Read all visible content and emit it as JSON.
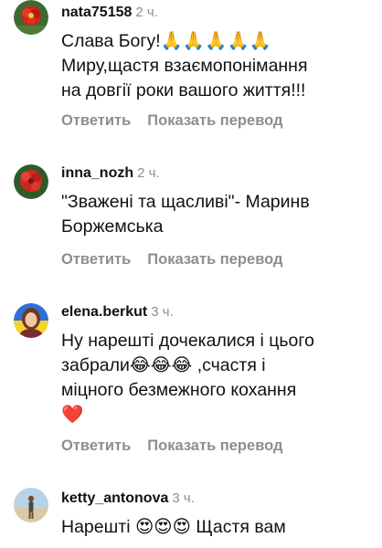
{
  "comments": [
    {
      "username": "nata75158",
      "time": "2 ч.",
      "text": "Слава Богу!🙏🙏🙏🙏🙏\nМиру,щастя взаємопонімання\nна довгії роки вашого життя!!!",
      "avatar": "red-flower-avatar",
      "reply_label": "Ответить",
      "translate_label": "Показать перевод"
    },
    {
      "username": "inna_nozh",
      "time": "2 ч.",
      "text": "\"Зважені та щасливі\"- Маринв\nБоржемська",
      "avatar": "red-flower-avatar",
      "reply_label": "Ответить",
      "translate_label": "Показать перевод"
    },
    {
      "username": "elena.berkut",
      "time": "3 ч.",
      "text": "Ну нарешті дочекалися і цього\nзабрали😂😂😂 ,счастя  і\nміцного безмежного кохання\n❤️",
      "avatar": "woman-portrait-avatar",
      "reply_label": "Ответить",
      "translate_label": "Показать перевод"
    },
    {
      "username": "ketty_antonova",
      "time": "3 ч.",
      "text": "Нарешті 😍😍😍 Щастя вам",
      "avatar": "beach-person-avatar"
    }
  ]
}
